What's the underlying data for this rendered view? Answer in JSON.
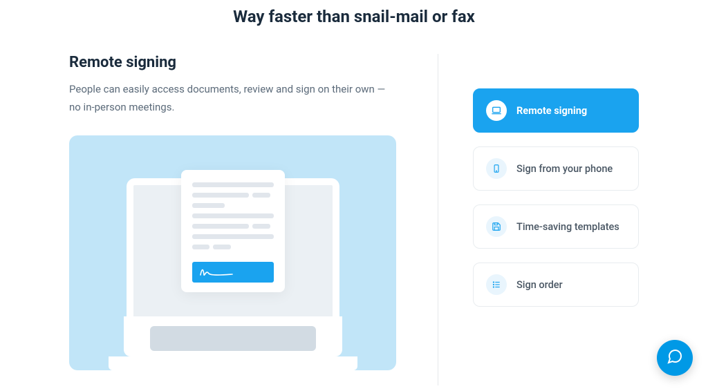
{
  "header": {
    "title": "Way faster than snail-mail or fax"
  },
  "feature": {
    "title": "Remote signing",
    "description": "People can easily access documents, review and sign on their own — no in-person meetings."
  },
  "options": [
    {
      "label": "Remote signing",
      "icon": "laptop-icon",
      "active": true
    },
    {
      "label": "Sign from your phone",
      "icon": "phone-icon",
      "active": false
    },
    {
      "label": "Time-saving templates",
      "icon": "save-icon",
      "active": false
    },
    {
      "label": "Sign order",
      "icon": "list-icon",
      "active": false
    }
  ],
  "colors": {
    "accent": "#1aa3ef",
    "illustration_bg": "#c1e5f8"
  }
}
